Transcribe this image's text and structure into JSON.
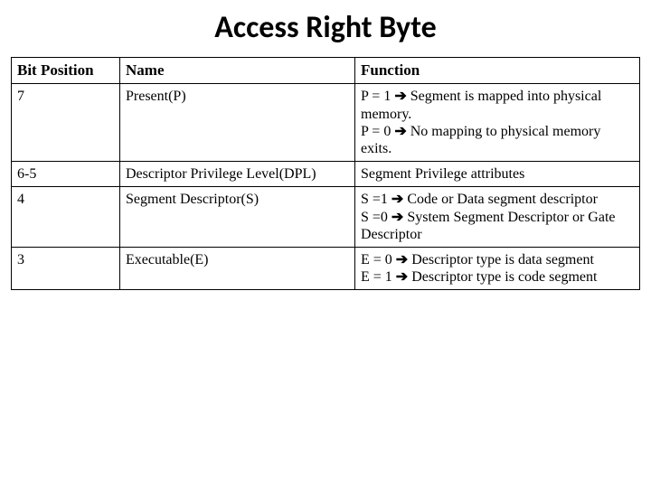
{
  "title": "Access Right Byte",
  "chart_data": {
    "type": "table",
    "columns": [
      "Bit Position",
      "Name",
      "Function"
    ],
    "rows": [
      {
        "bit": "7",
        "name": "Present(P)",
        "func": [
          "P = 1 → Segment is mapped into physical memory.",
          "P = 0 → No mapping to physical memory exits."
        ]
      },
      {
        "bit": "6-5",
        "name": "Descriptor Privilege Level(DPL)",
        "func": [
          "Segment Privilege attributes"
        ]
      },
      {
        "bit": "4",
        "name": "Segment Descriptor(S)",
        "func": [
          "S =1 → Code or Data segment descriptor",
          "S =0 → System Segment Descriptor or Gate Descriptor"
        ]
      },
      {
        "bit": "3",
        "name": "Executable(E)",
        "func": [
          "E = 0 → Descriptor type is data segment",
          "E = 1 → Descriptor type is code segment"
        ]
      }
    ]
  },
  "headers": {
    "bit": "Bit Position",
    "name": "Name",
    "func": "Function"
  },
  "rows": {
    "r0": {
      "bit": "7",
      "name": "Present(P)",
      "f0a": "P = 1 ",
      "f0b": " Segment is mapped into physical memory.",
      "f1a": "P = 0 ",
      "f1b": " No mapping to physical memory exits."
    },
    "r1": {
      "bit": "6-5",
      "name": "Descriptor Privilege Level(DPL)",
      "f0": "Segment Privilege attributes"
    },
    "r2": {
      "bit": "4",
      "name": "Segment Descriptor(S)",
      "f0a": "S =1 ",
      "f0b": " Code or Data segment descriptor",
      "f1a": "S =0 ",
      "f1b": " System Segment Descriptor or Gate Descriptor"
    },
    "r3": {
      "bit": "3",
      "name": "Executable(E)",
      "f0a": "E = 0 ",
      "f0b": " Descriptor type is data segment",
      "f1a": "E = 1 ",
      "f1b": " Descriptor type is code segment"
    }
  },
  "arrow": "➔"
}
